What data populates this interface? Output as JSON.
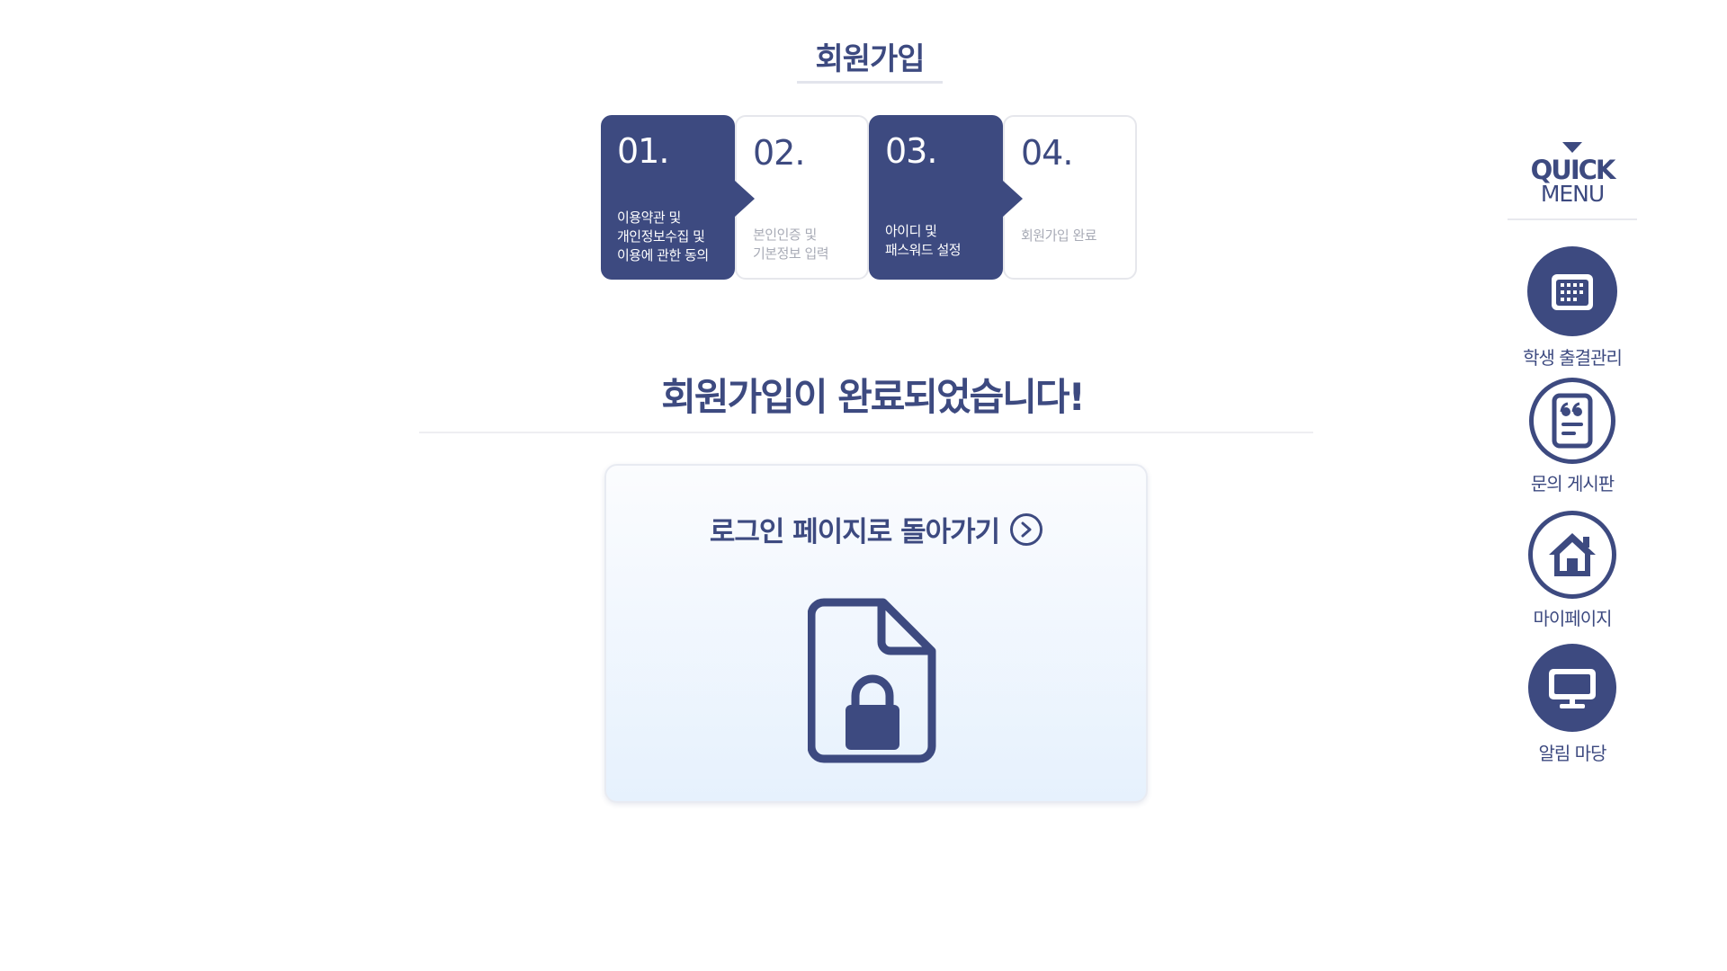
{
  "page": {
    "title": "회원가입",
    "complete_message": "회원가입이 완료되었습니다!"
  },
  "steps": [
    {
      "number": "01.",
      "description": "이용약관 및\n개인정보수집 및\n이용에 관한 동의",
      "active": true
    },
    {
      "number": "02.",
      "description": "본인인증 및\n기본정보 입력",
      "active": false
    },
    {
      "number": "03.",
      "description": "아이디 및\n패스워드 설정",
      "active": true
    },
    {
      "number": "04.",
      "description": "회원가입 완료",
      "active": false
    }
  ],
  "login_card": {
    "label": "로그인 페이지로 돌아가기",
    "icon": "document-lock-icon"
  },
  "quick_menu": {
    "title": "QUICK",
    "subtitle": "MENU",
    "items": [
      {
        "label": "학생 출결관리",
        "icon": "calendar-icon"
      },
      {
        "label": "문의 게시판",
        "icon": "quote-document-icon"
      },
      {
        "label": "마이페이지",
        "icon": "home-icon"
      },
      {
        "label": "알림 마당",
        "icon": "monitor-icon"
      }
    ]
  },
  "colors": {
    "primary": "#3d4a80",
    "muted_text": "#a8abb6",
    "card_gradient_top": "#fbfcfe",
    "card_gradient_bottom": "#e6f1fd"
  }
}
